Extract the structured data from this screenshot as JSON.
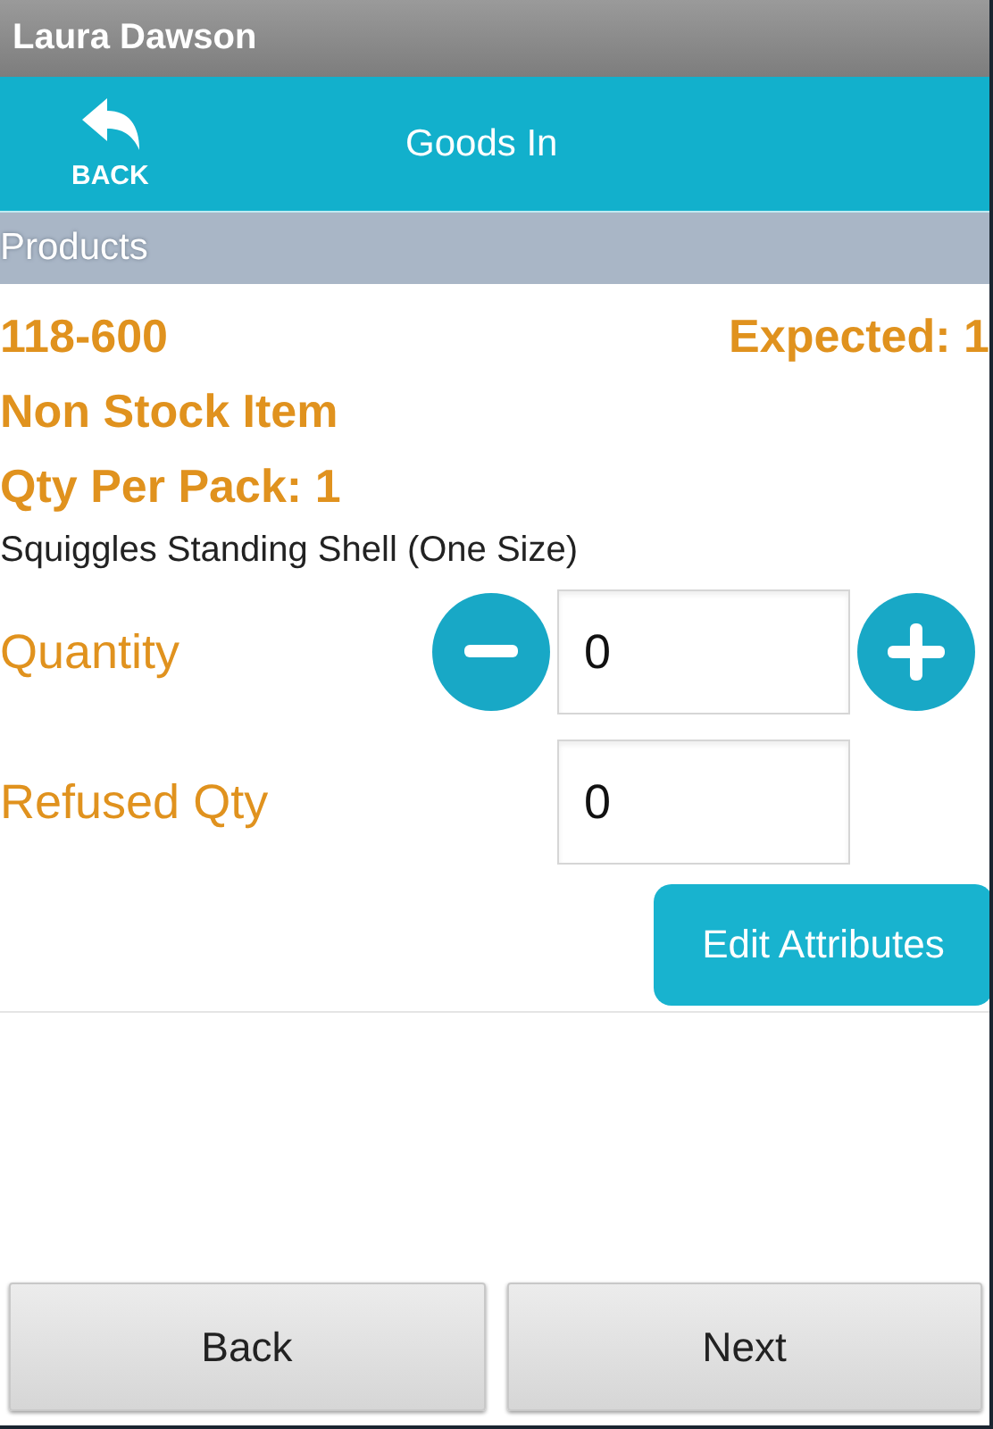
{
  "status_bar": {
    "user": "Laura Dawson"
  },
  "header": {
    "back_label": "BACK",
    "title": "Goods In"
  },
  "section": {
    "title": "Products"
  },
  "product": {
    "code": "118-600",
    "expected": "Expected: 1",
    "type": "Non Stock Item",
    "qty_per_pack": "Qty Per Pack: 1",
    "description": "Squiggles Standing Shell (One Size)"
  },
  "fields": [
    {
      "label": "Quantity",
      "value": "0",
      "kind": "stepper"
    },
    {
      "label": "Refused Qty",
      "value": "0",
      "kind": "plain"
    }
  ],
  "edit_button": "Edit Attributes",
  "buttons": [
    "Back",
    "Next"
  ]
}
